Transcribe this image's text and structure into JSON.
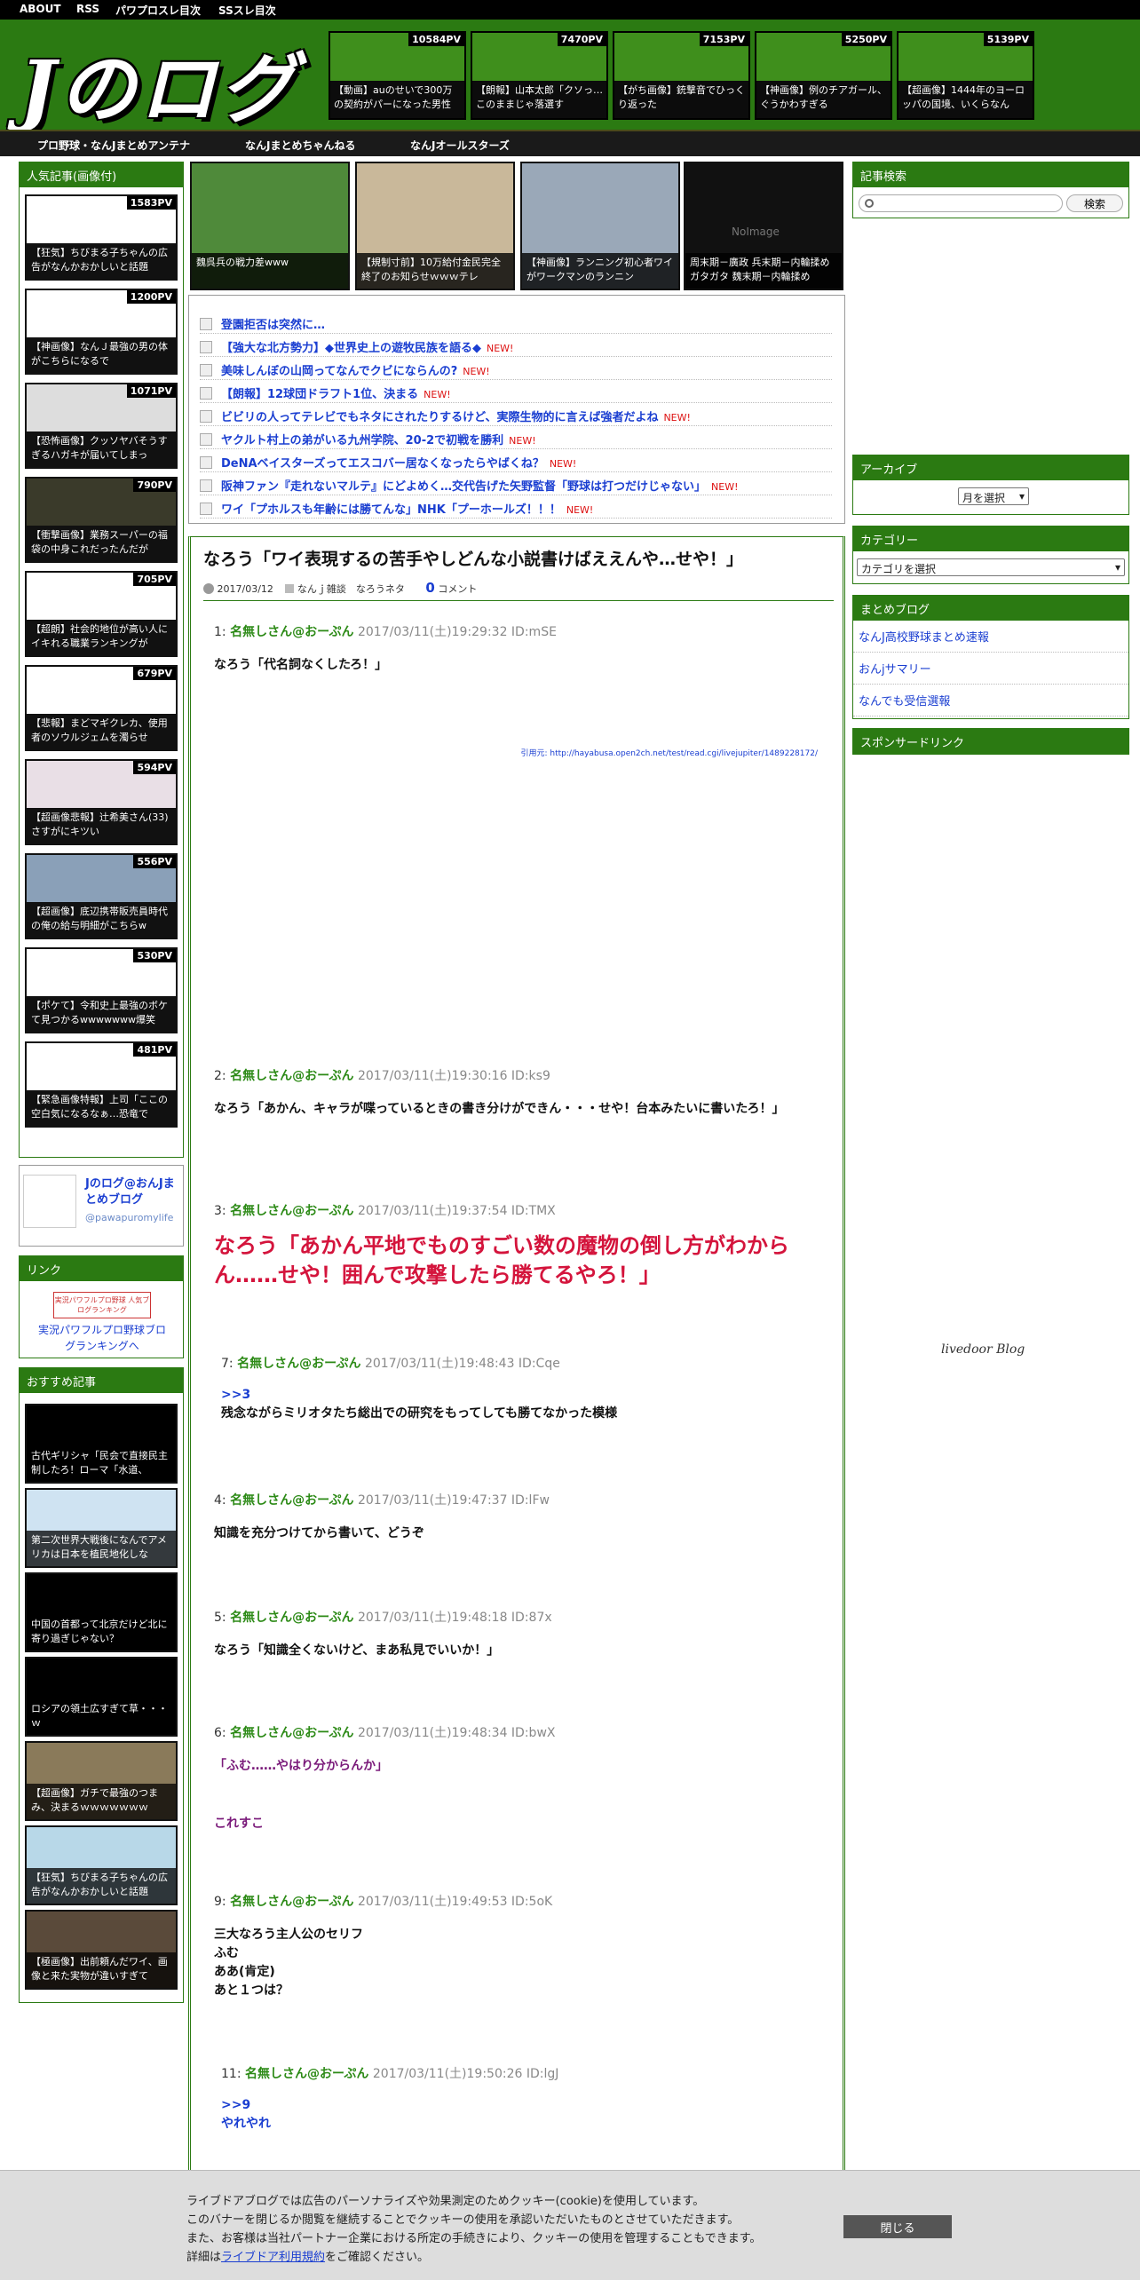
{
  "topnav": [
    "ABOUT",
    "RSS",
    "パワプロスレ目次",
    "SSスレ目次"
  ],
  "logo": "Jのログ",
  "header_cards": [
    {
      "pv": "10584PV",
      "caption": "【動画】auのせいで300万の契約がパーになった男性"
    },
    {
      "pv": "7470PV",
      "caption": "【朗報】山本太郎「クソっ…このままじゃ落選す"
    },
    {
      "pv": "7153PV",
      "caption": "【がち画像】銃撃音でひっくり返った"
    },
    {
      "pv": "5250PV",
      "caption": "【神画像】例のチアガール、ぐうかわすぎる"
    },
    {
      "pv": "5139PV",
      "caption": "【超画像】1444年のヨーロッパの国境、いくらなん"
    }
  ],
  "mainnav": [
    "プロ野球・なんJまとめアンテナ",
    "なんJまとめちゃんねる",
    "なんJオールスターズ"
  ],
  "popular": {
    "heading": "人気記事(画像付)",
    "items": [
      {
        "pv": "1583PV",
        "caption": "【狂気】ちびまる子ちゃんの広告がなんかおかしいと話題"
      },
      {
        "pv": "1200PV",
        "caption": "【神画像】なんＪ最強の男の体がこちらになるで"
      },
      {
        "pv": "1071PV",
        "caption": "【恐怖画像】クッソヤバそうすぎるハガキが届いてしまっ"
      },
      {
        "pv": "790PV",
        "caption": "【衝撃画像】業務スーパーの福袋の中身これだったんだが"
      },
      {
        "pv": "705PV",
        "caption": "【超朗】社会的地位が高い人にイキれる職業ランキングが"
      },
      {
        "pv": "679PV",
        "caption": "【悲報】まどマギクレカ、使用者のソウルジェムを濁らせ"
      },
      {
        "pv": "594PV",
        "caption": "【超画像悲報】辻希美さん(33)さすがにキツい"
      },
      {
        "pv": "556PV",
        "caption": "【超画像】底辺携帯販売員時代の俺の給与明細がこちらw"
      },
      {
        "pv": "530PV",
        "caption": "【ポケて】令和史上最強のボケて見つかるwwwwwww爆笑"
      },
      {
        "pv": "481PV",
        "caption": "【緊急画像特報】上司「ここの空白気になるなぁ…恐竜で"
      }
    ]
  },
  "twitter": {
    "name": "Jのログ@おんJまとめブログ",
    "handle": "@pawapuromylife"
  },
  "link": {
    "heading": "リンク",
    "badge": "実況パワフルプロ野球 人気ブログランキング",
    "text": "実況パワフルプロ野球ブログランキングへ"
  },
  "recommend": {
    "heading": "おすすめ記事",
    "items": [
      "古代ギリシャ「民会で直接民主制したろ！ローマ「水道、",
      "第二次世界大戦後になんでアメリカは日本を植民地化しな",
      "中国の首都って北京だけど北に寄り過ぎじゃない？",
      "ロシアの領土広すぎて草・・・ｗ",
      "【超画像】ガチで最強のつまみ、決まるｗｗｗｗｗｗｗ",
      "【狂気】ちびまる子ちゃんの広告がなんかおかしいと話題",
      "【極画像】出前頼んだワイ、画像と来た実物が違いすぎて"
    ]
  },
  "thumbs": [
    {
      "caption": "魏呉兵の戦力差www"
    },
    {
      "caption": "【規制寸前】10万給付金民完全終了のお知らせｗｗｗテレ"
    },
    {
      "caption": "【神画像】ランニング初心者ワイがワークマンのランニン"
    },
    {
      "caption": "周末期－廣政 兵末期－内輪揉めガタガタ 魏末期－内輪揉め",
      "noimage": "NoImage"
    }
  ],
  "ticker": [
    {
      "title": "登園拒否は突然に…",
      "new": ""
    },
    {
      "title": "【強大な北方勢力】◆世界史上の遊牧民族を語る◆",
      "new": "NEW!"
    },
    {
      "title": "美味しんぼの山岡ってなんでクビにならんの?",
      "new": "NEW!"
    },
    {
      "title": "【朗報】12球団ドラフト1位、決まる",
      "new": "NEW!"
    },
    {
      "title": "ビビリの人ってテレビでもネタにされたりするけど、実際生物的に言えば強者だよね",
      "new": "NEW!"
    },
    {
      "title": "ヤクルト村上の弟がいる九州学院、20-2で初戦を勝利",
      "new": "NEW!"
    },
    {
      "title": "DeNAベイスターズってエスコバー居なくなったらやばくね？",
      "new": "NEW!"
    },
    {
      "title": "阪神ファン『走れないマルテ』にどよめく…交代告げた矢野監督「野球は打つだけじゃない」",
      "new": "NEW!"
    },
    {
      "title": "ワイ「プホルスも年齢には勝てんな」NHK「プーホールズ！！！",
      "new": "NEW!"
    }
  ],
  "article": {
    "title": "なろう「ワイ表現するの苦手やしどんな小説書けばええんや…せや！」",
    "date": "2017/03/12",
    "categories": "なんｊ雑談　なろうネタ",
    "comments": "0",
    "comments_label": "コメント",
    "source": "引用元: http://hayabusa.open2ch.net/test/read.cgi/livejupiter/1489228172/",
    "posts": [
      {
        "num": "1:",
        "name": "名無しさん@おーぷん",
        "meta": "2017/03/11(土)19:29:32 ID:mSE",
        "body": "なろう「代名詞なくしたろ！」"
      },
      {
        "num": "2:",
        "name": "名無しさん@おーぷん",
        "meta": "2017/03/11(土)19:30:16 ID:ks9",
        "body": "なろう「あかん、キャラが喋っているときの書き分けができん・・・せや！台本みたいに書いたろ！」"
      },
      {
        "num": "3:",
        "name": "名無しさん@おーぷん",
        "meta": "2017/03/11(土)19:37:54 ID:TMX",
        "body": "なろう「あかん平地でものすごい数の魔物の倒し方がわからん……せや！囲んで攻撃したら勝てるやろ！」"
      },
      {
        "num": "7:",
        "name": "名無しさん@おーぷん",
        "meta": "2017/03/11(土)19:48:43 ID:Cqe",
        "anchor": ">>3",
        "body": "残念ながらミリオタたち総出での研究をもってしても勝てなかった模様"
      },
      {
        "num": "4:",
        "name": "名無しさん@おーぷん",
        "meta": "2017/03/11(土)19:47:37 ID:lFw",
        "body": "知識を充分つけてから書いて、どうぞ"
      },
      {
        "num": "5:",
        "name": "名無しさん@おーぷん",
        "meta": "2017/03/11(土)19:48:18 ID:87x",
        "body": "なろう「知識全くないけど、まあ私見でいいか！」"
      },
      {
        "num": "6:",
        "name": "名無しさん@おーぷん",
        "meta": "2017/03/11(土)19:48:34 ID:bwX",
        "body": "「ふむ……やはり分からんか」",
        "body2": "これすこ"
      },
      {
        "num": "9:",
        "name": "名無しさん@おーぷん",
        "meta": "2017/03/11(土)19:49:53 ID:5oK",
        "lines": [
          "三大なろう主人公のセリフ",
          "ふむ",
          "ああ(肯定)",
          "あと１つは？"
        ]
      },
      {
        "num": "11:",
        "name": "名無しさん@おーぷん",
        "meta": "2017/03/11(土)19:50:26 ID:lgJ",
        "anchor": ">>9",
        "body": "やれやれ"
      }
    ]
  },
  "search": {
    "heading": "記事検索",
    "button": "検索",
    "placeholder": ""
  },
  "archive": {
    "heading": "アーカイブ",
    "select": "月を選択"
  },
  "category": {
    "heading": "カテゴリー",
    "select": "カテゴリを選択"
  },
  "matome": {
    "heading": "まとめブログ",
    "links": [
      "なんJ高校野球まとめ速報",
      "おんjサマリー",
      "なんでも受信選報"
    ]
  },
  "sponsor": {
    "heading": "スポンサードリンク"
  },
  "livedoor": "livedoor Blog",
  "cookie": {
    "lines": [
      "ライブドアブログでは広告のパーソナライズや効果測定のためクッキー(cookie)を使用しています。",
      "このバナーを閉じるか閲覧を継続することでクッキーの使用を承認いただいたものとさせていただきます。",
      "また、お客様は当社パートナー企業における所定の手続きにより、クッキーの使用を管理することもできます。"
    ],
    "detail_pre": "詳細は",
    "detail_link": "ライブドア利用規約",
    "detail_post": "をご確認ください。",
    "close": "閉じる"
  },
  "colors": {
    "green": "#2b7a12",
    "red_big": "#d4143c",
    "purple": "#7a1a7a",
    "link_blue": "#1a3ed1"
  }
}
